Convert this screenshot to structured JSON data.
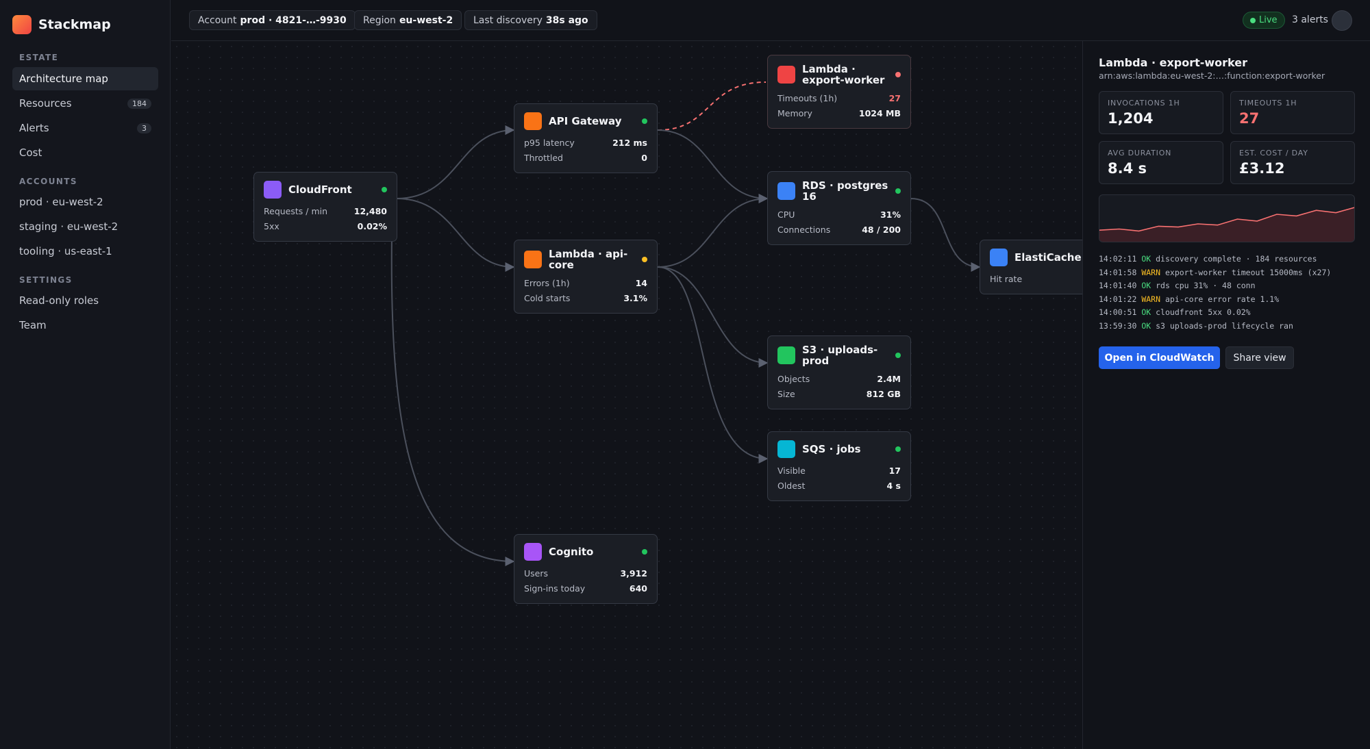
{
  "brand": {
    "name": "Stackmap"
  },
  "sidebar": {
    "estate_label": "ESTATE",
    "estate_items": [
      {
        "label": "Architecture map",
        "badge": ""
      },
      {
        "label": "Resources",
        "badge": "184"
      },
      {
        "label": "Alerts",
        "badge": "3"
      },
      {
        "label": "Cost",
        "badge": ""
      }
    ],
    "accounts_label": "ACCOUNTS",
    "accounts": [
      {
        "label": "prod · eu-west-2"
      },
      {
        "label": "staging · eu-west-2"
      },
      {
        "label": "tooling · us-east-1"
      }
    ],
    "settings_label": "SETTINGS",
    "settings": [
      {
        "label": "Read-only roles"
      },
      {
        "label": "Team"
      }
    ]
  },
  "topbar": {
    "account_label": "Account",
    "account_value": "prod · 4821-…-9930",
    "region_label": "Region",
    "region_value": "eu-west-2",
    "discovery_label": "Last discovery",
    "discovery_value": "38s ago",
    "live": "Live",
    "alerts": "3 alerts"
  },
  "colors": {
    "ok": "#22c55e",
    "warn": "#fbbf24",
    "error": "#f87171",
    "accent": "#2563eb"
  },
  "nodes": {
    "cloudfront": {
      "title": "CloudFront",
      "icon": "cloudfront-icon",
      "icon_color": "#8b5cf6",
      "status": "ok",
      "metrics": [
        {
          "label": "Requests / min",
          "value": "12,480"
        },
        {
          "label": "5xx",
          "value": "0.02%"
        }
      ]
    },
    "api_gateway": {
      "title": "API Gateway",
      "icon": "api-gateway-icon",
      "icon_color": "#f97316",
      "status": "ok",
      "metrics": [
        {
          "label": "p95 latency",
          "value": "212 ms"
        },
        {
          "label": "Throttled",
          "value": "0"
        }
      ]
    },
    "lambda_api": {
      "title": "Lambda · api-core",
      "icon": "lambda-icon",
      "icon_color": "#f97316",
      "status": "warn",
      "metrics": [
        {
          "label": "Errors (1h)",
          "value": "14"
        },
        {
          "label": "Cold starts",
          "value": "3.1%"
        }
      ]
    },
    "cognito": {
      "title": "Cognito",
      "icon": "cognito-icon",
      "icon_color": "#a855f7",
      "status": "ok",
      "metrics": [
        {
          "label": "Users",
          "value": "3,912"
        },
        {
          "label": "Sign-ins today",
          "value": "640"
        }
      ]
    },
    "lambda_export": {
      "title": "Lambda · export-worker",
      "icon": "lambda-icon",
      "icon_color": "#ef4444",
      "status": "error",
      "metrics": [
        {
          "label": "Timeouts (1h)",
          "value": "27"
        },
        {
          "label": "Memory",
          "value": "1024 MB"
        }
      ]
    },
    "rds": {
      "title": "RDS · postgres 16",
      "icon": "database-icon",
      "icon_color": "#3b82f6",
      "status": "ok",
      "metrics": [
        {
          "label": "CPU",
          "value": "31%"
        },
        {
          "label": "Connections",
          "value": "48 / 200"
        }
      ]
    },
    "s3": {
      "title": "S3 · uploads-prod",
      "icon": "bucket-icon",
      "icon_color": "#22c55e",
      "status": "ok",
      "metrics": [
        {
          "label": "Objects",
          "value": "2.4M"
        },
        {
          "label": "Size",
          "value": "812 GB"
        }
      ]
    },
    "sqs": {
      "title": "SQS · jobs",
      "icon": "queue-icon",
      "icon_color": "#06b6d4",
      "status": "ok",
      "metrics": [
        {
          "label": "Visible",
          "value": "17"
        },
        {
          "label": "Oldest",
          "value": "4 s"
        }
      ]
    },
    "elasticache": {
      "title": "ElastiCache",
      "icon": "cache-icon",
      "icon_color": "#3b82f6",
      "status": "",
      "metrics": [
        {
          "label": "Hit rate",
          "value": ""
        }
      ]
    }
  },
  "panel": {
    "title": "Lambda · export-worker",
    "arn": "arn:aws:lambda:eu-west-2:…:function:export-worker",
    "stats": [
      {
        "label": "INVOCATIONS 1H",
        "value": "1,204"
      },
      {
        "label": "TIMEOUTS 1H",
        "value": "27"
      },
      {
        "label": "AVG DURATION",
        "value": "8.4 s"
      },
      {
        "label": "EST. COST / DAY",
        "value": "£3.12"
      }
    ],
    "sparkline": [
      0.22,
      0.25,
      0.2,
      0.32,
      0.3,
      0.38,
      0.35,
      0.5,
      0.45,
      0.62,
      0.58,
      0.72,
      0.66,
      0.8
    ],
    "log": [
      {
        "time": "14:02:11",
        "level": "OK",
        "message": "discovery complete · 184 resources"
      },
      {
        "time": "14:01:58",
        "level": "WARN",
        "message": "export-worker timeout 15000ms (x27)"
      },
      {
        "time": "14:01:40",
        "level": "OK",
        "message": "rds cpu 31% · 48 conn"
      },
      {
        "time": "14:01:22",
        "level": "WARN",
        "message": "api-core error rate 1.1%"
      },
      {
        "time": "14:00:51",
        "level": "OK",
        "message": "cloudfront 5xx 0.02%"
      },
      {
        "time": "13:59:30",
        "level": "OK",
        "message": "s3 uploads-prod lifecycle ran"
      }
    ],
    "primary_button": "Open in CloudWatch",
    "secondary_button": "Share view"
  }
}
